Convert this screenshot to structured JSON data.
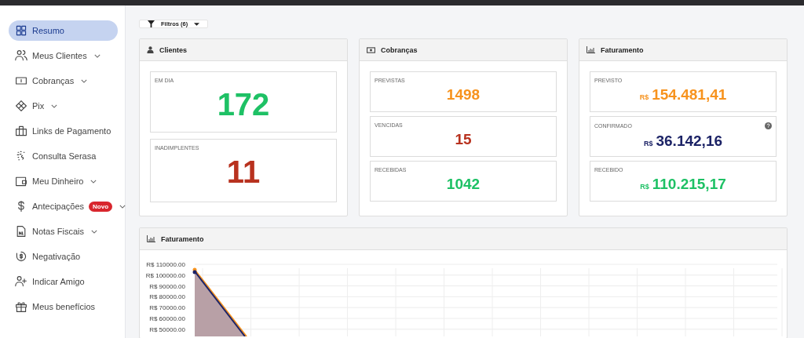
{
  "sidebar": {
    "items": [
      {
        "label": "Resumo",
        "selected": true,
        "expandable": false
      },
      {
        "label": "Meus Clientes",
        "selected": false,
        "expandable": true
      },
      {
        "label": "Cobranças",
        "selected": false,
        "expandable": true
      },
      {
        "label": "Pix",
        "selected": false,
        "expandable": true
      },
      {
        "label": "Links de Pagamento",
        "selected": false,
        "expandable": false
      },
      {
        "label": "Consulta Serasa",
        "selected": false,
        "expandable": false
      },
      {
        "label": "Meu Dinheiro",
        "selected": false,
        "expandable": true
      },
      {
        "label": "Antecipações",
        "selected": false,
        "expandable": true,
        "badge": "Novo"
      },
      {
        "label": "Notas Fiscais",
        "selected": false,
        "expandable": true
      },
      {
        "label": "Negativação",
        "selected": false,
        "expandable": false
      },
      {
        "label": "Indicar Amigo",
        "selected": false,
        "expandable": false
      },
      {
        "label": "Meus benefícios",
        "selected": false,
        "expandable": false
      }
    ]
  },
  "filter_button": {
    "label": "Filtros (6)"
  },
  "cards": [
    {
      "title": "Clientes",
      "kind": "large",
      "stats": [
        {
          "label": "EM DIA",
          "value": "172",
          "color": "#1ec165"
        },
        {
          "label": "INADIMPLENTES",
          "value": "11",
          "color": "#b8321f"
        }
      ]
    },
    {
      "title": "Cobranças",
      "kind": "compact",
      "stats": [
        {
          "label": "PREVISTAS",
          "value": "1498",
          "color": "#f7931e"
        },
        {
          "label": "VENCIDAS",
          "value": "15",
          "color": "#b8321f"
        },
        {
          "label": "RECEBIDAS",
          "value": "1042",
          "color": "#1ec165"
        }
      ]
    },
    {
      "title": "Faturamento",
      "kind": "compact",
      "stats": [
        {
          "label": "PREVISTO",
          "currency": "R$",
          "value": "154.481,41",
          "color": "#f7931e"
        },
        {
          "label": "CONFIRMADO",
          "currency": "R$",
          "value": "36.142,16",
          "color": "#1c2366",
          "help": true
        },
        {
          "label": "RECEBIDO",
          "currency": "R$",
          "value": "110.215,17",
          "color": "#1ec165"
        }
      ]
    }
  ],
  "chart_panel": {
    "title": "Faturamento",
    "y_tick_labels": [
      "R$ 110000.00",
      "R$ 100000.00",
      "R$ 90000.00",
      "R$ 80000.00",
      "R$ 70000.00",
      "R$ 60000.00",
      "R$ 50000.00"
    ]
  }
}
